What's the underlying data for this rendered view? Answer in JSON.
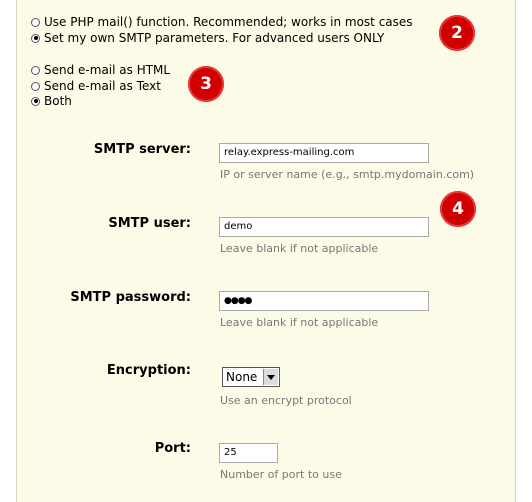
{
  "mail_method": {
    "options": [
      {
        "label": "Use PHP mail() function. Recommended; works in most cases",
        "checked": false
      },
      {
        "label": "Set my own SMTP parameters. For advanced users ONLY",
        "checked": true
      }
    ]
  },
  "mail_format": {
    "options": [
      {
        "label": "Send e-mail as HTML",
        "checked": false
      },
      {
        "label": "Send e-mail as Text",
        "checked": false
      },
      {
        "label": "Both",
        "checked": true
      }
    ]
  },
  "badges": [
    "2",
    "3",
    "4"
  ],
  "smtp": {
    "server": {
      "label": "SMTP server:",
      "value": "relay.express-mailing.com",
      "hint": "IP or server name (e.g., smtp.mydomain.com)"
    },
    "user": {
      "label": "SMTP user:",
      "value": "demo",
      "hint": "Leave blank if not applicable"
    },
    "password": {
      "label": "SMTP password:",
      "value": "●●●●",
      "hint": "Leave blank if not applicable"
    },
    "encryption": {
      "label": "Encryption:",
      "value": "None",
      "hint": "Use an encrypt protocol"
    },
    "port": {
      "label": "Port:",
      "value": "25",
      "hint": "Number of port to use"
    }
  },
  "colors": {
    "badge": "#d00000",
    "panel": "#fcfbe8",
    "hint": "#777777"
  }
}
